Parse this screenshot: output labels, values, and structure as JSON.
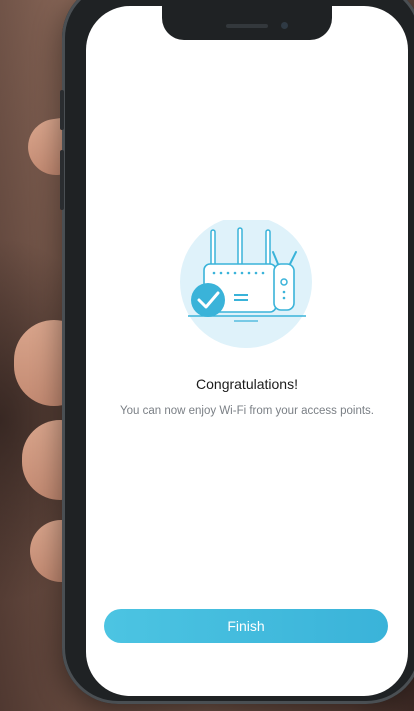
{
  "setup_complete": {
    "title": "Congratulations!",
    "message": "You can now enjoy Wi-Fi from your access points.",
    "finish_label": "Finish"
  },
  "illustration": {
    "icon": "router-with-range-extender-success-icon",
    "check_icon": "checkmark-circle-icon"
  },
  "colors": {
    "accent": "#3ab3d9",
    "accent_light": "#dff2fa",
    "title": "#1b1b1b",
    "body": "#7a7f85"
  }
}
